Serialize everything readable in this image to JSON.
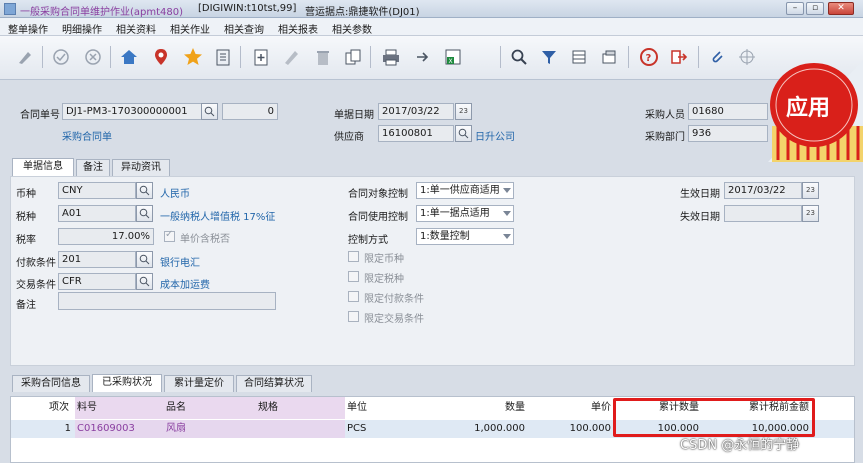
{
  "window": {
    "title": "一般采购合同单维护作业(apmt480)",
    "session": "[DIGIWIN:t10tst,99]",
    "site": "营运据点:鼎捷软件(DJ01)"
  },
  "menu": [
    "整单操作",
    "明细操作",
    "相关资料",
    "相关作业",
    "相关查询",
    "相关报表",
    "相关参数"
  ],
  "toolbar_icons": [
    "edit-icon",
    "confirm-icon",
    "cancel-icon",
    "home-icon",
    "location-icon",
    "favorite-icon",
    "list-icon",
    "new-icon",
    "modify-icon",
    "delete-icon",
    "copy-icon",
    "print-icon",
    "export-icon",
    "excel-icon",
    "attachment-page-icon",
    "query-icon",
    "filter-icon",
    "columns-icon",
    "layout-icon",
    "help-icon",
    "exit-icon",
    "clip-icon",
    "crosshair-icon"
  ],
  "header": {
    "contract_no_label": "合同单号",
    "contract_no": "DJ1-PM3-170300000001",
    "contract_seq": "0",
    "contract_type": "采购合同单",
    "doc_date_label": "单据日期",
    "doc_date": "2017/03/22",
    "supplier_label": "供应商",
    "supplier_code": "16100801",
    "supplier_name": "日升公司",
    "buyer_label": "采购人员",
    "buyer_code": "01680",
    "dept_label": "采购部门",
    "dept_code": "936",
    "stamp_text": "应用"
  },
  "tabs": [
    "单据信息",
    "备注",
    "异动资讯"
  ],
  "info": {
    "currency_label": "币种",
    "currency": "CNY",
    "currency_name": "人民币",
    "tax_label": "税种",
    "tax": "A01",
    "tax_name": "一般纳税人增值税 17%征",
    "rate_label": "税率",
    "rate": "17.00%",
    "price_incl_tax": "单价含税否",
    "payment_label": "付款条件",
    "payment": "201",
    "payment_name": "银行电汇",
    "trade_label": "交易条件",
    "trade": "CFR",
    "trade_name": "成本加运费",
    "remark_label": "备注",
    "remark": "",
    "target_ctrl_label": "合同对象控制",
    "target_ctrl": "1:单一供应商适用",
    "use_ctrl_label": "合同使用控制",
    "use_ctrl": "1:单一据点适用",
    "ctrl_mode_label": "控制方式",
    "ctrl_mode": "1:数量控制",
    "limits": [
      "限定币种",
      "限定税种",
      "限定付款条件",
      "限定交易条件"
    ],
    "eff_date_label": "生效日期",
    "eff_date": "2017/03/22",
    "exp_date_label": "失效日期",
    "exp_date": ""
  },
  "detail_tabs": [
    "采购合同信息",
    "已采购状况",
    "累计量定价",
    "合同结算状况"
  ],
  "grid": {
    "headers": [
      "项次",
      "料号",
      "品名",
      "规格",
      "单位",
      "数量",
      "单价",
      "累计数量",
      "累计税前金额"
    ],
    "rows": [
      [
        "1",
        "C01609003",
        "风扇",
        "",
        "PCS",
        "1,000.000",
        "100.000",
        "100.000",
        "10,000.000"
      ]
    ]
  },
  "watermark": "CSDN @永恒的宁静",
  "colors": {
    "highlight": "#e01b1b",
    "link": "#2266aa",
    "stamp": "#d9201a"
  }
}
